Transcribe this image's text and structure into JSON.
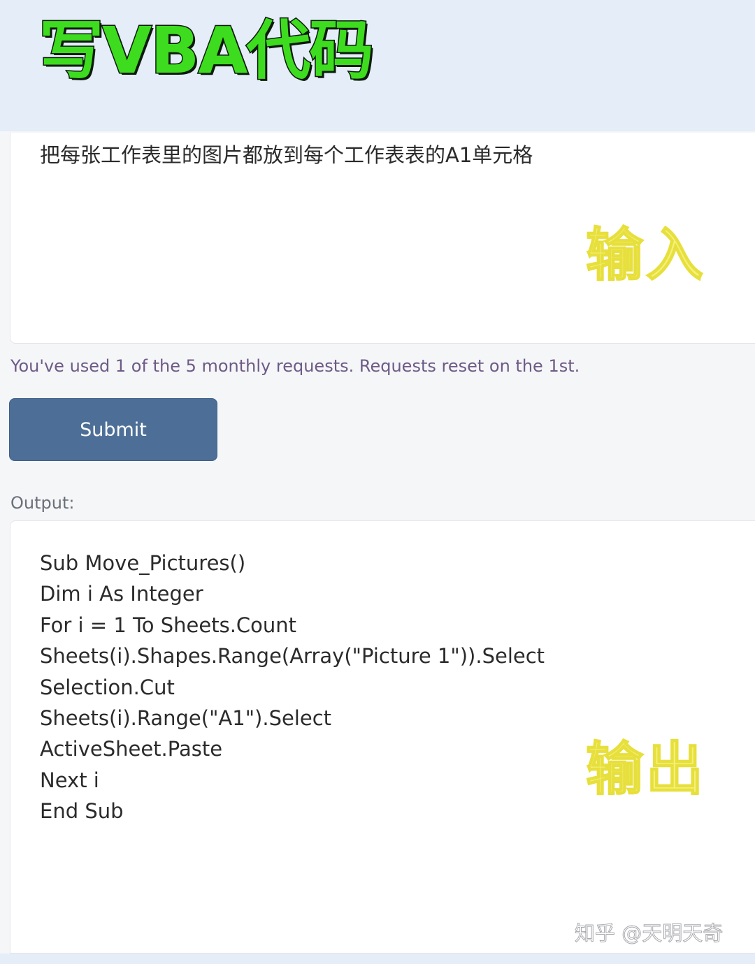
{
  "title": "写VBA代码",
  "input": {
    "text": "把每张工作表里的图片都放到每个工作表表的A1单元格",
    "sticker": "输入"
  },
  "usage_note": "You've used 1 of the 5 monthly requests. Requests reset on the 1st.",
  "submit_label": "Submit",
  "output": {
    "label": "Output:",
    "lines": [
      "Sub Move_Pictures()",
      "Dim i As Integer",
      "For i = 1 To Sheets.Count",
      "Sheets(i).Shapes.Range(Array(\"Picture 1\")).Select",
      "Selection.Cut",
      "Sheets(i).Range(\"A1\").Select",
      "ActiveSheet.Paste",
      "Next i",
      "End Sub"
    ],
    "sticker": "输出"
  },
  "watermark": "知乎 @天明天奇",
  "colors": {
    "title_green": "#3ddc1f",
    "sticker_yellow": "#f4f17a",
    "submit_blue": "#4d6f97",
    "note_purple": "#6e5a86",
    "header_band": "#e4edf8"
  }
}
